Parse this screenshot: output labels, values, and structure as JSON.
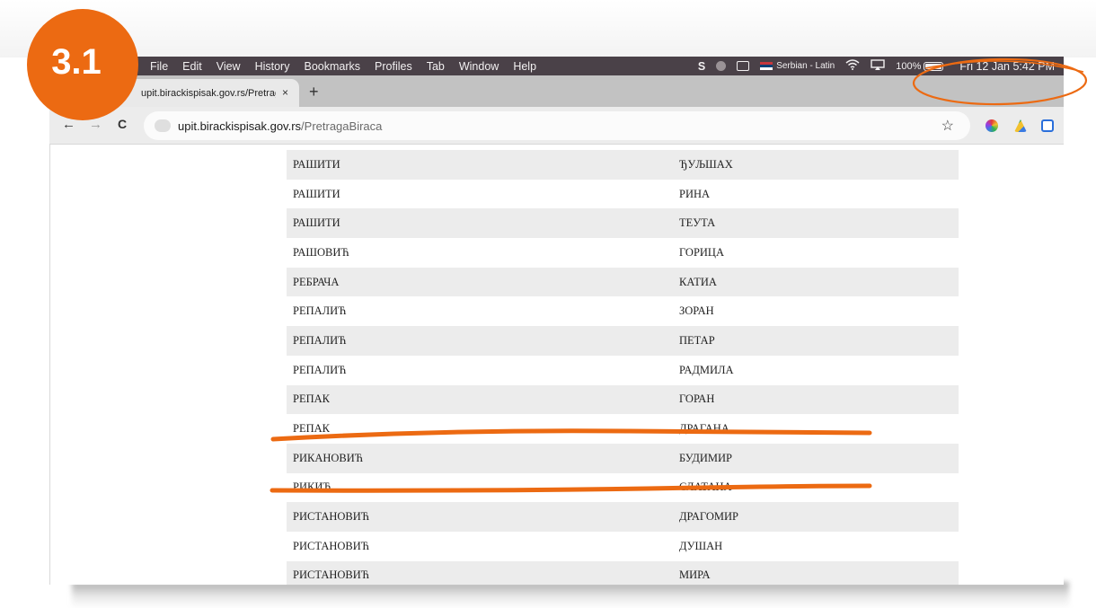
{
  "badge": {
    "label": "3.1"
  },
  "menubar": {
    "items": [
      "File",
      "Edit",
      "View",
      "History",
      "Bookmarks",
      "Profiles",
      "Tab",
      "Window",
      "Help"
    ],
    "status": {
      "s_glyph": "S",
      "language": "Serbian - Latin",
      "battery": "100%",
      "datetime": "Fri 12 Jan  5:42 PM"
    }
  },
  "browser": {
    "tab_title": "upit.birackispisak.gov.rs/PretragaBiraca",
    "tab_close": "×",
    "new_tab": "+",
    "back": "←",
    "forward": "→",
    "reload": "C",
    "url_domain": "upit.birackispisak.gov.rs",
    "url_path": "/PretragaBiraca",
    "bookmark_star": "☆"
  },
  "voters": [
    {
      "surname": "РАШИТИ",
      "name": "ЂУЉШАХ"
    },
    {
      "surname": "РАШИТИ",
      "name": "РИНА"
    },
    {
      "surname": "РАШИТИ",
      "name": "ТЕУТА"
    },
    {
      "surname": "РАШОВИЋ",
      "name": "ГОРИЦА"
    },
    {
      "surname": "РЕБРАЧА",
      "name": "КАТИА"
    },
    {
      "surname": "РЕПАЛИЋ",
      "name": "ЗОРАН"
    },
    {
      "surname": "РЕПАЛИЋ",
      "name": "ПЕТАР"
    },
    {
      "surname": "РЕПАЛИЋ",
      "name": "РАДМИЛА"
    },
    {
      "surname": "РЕПАК",
      "name": "ГОРАН"
    },
    {
      "surname": "РЕПАК",
      "name": "ДРАГАНА"
    },
    {
      "surname": "РИКАНОВИЋ",
      "name": "БУДИМИР"
    },
    {
      "surname": "РИКИЋ",
      "name": "СЛАТАНА"
    },
    {
      "surname": "РИСТАНОВИЋ",
      "name": "ДРАГОМИР"
    },
    {
      "surname": "РИСТАНОВИЋ",
      "name": "ДУШАН"
    },
    {
      "surname": "РИСТАНОВИЋ",
      "name": "МИРА"
    }
  ],
  "colors": {
    "annotation": "#ec6a12",
    "menubar": "#4a4148"
  }
}
